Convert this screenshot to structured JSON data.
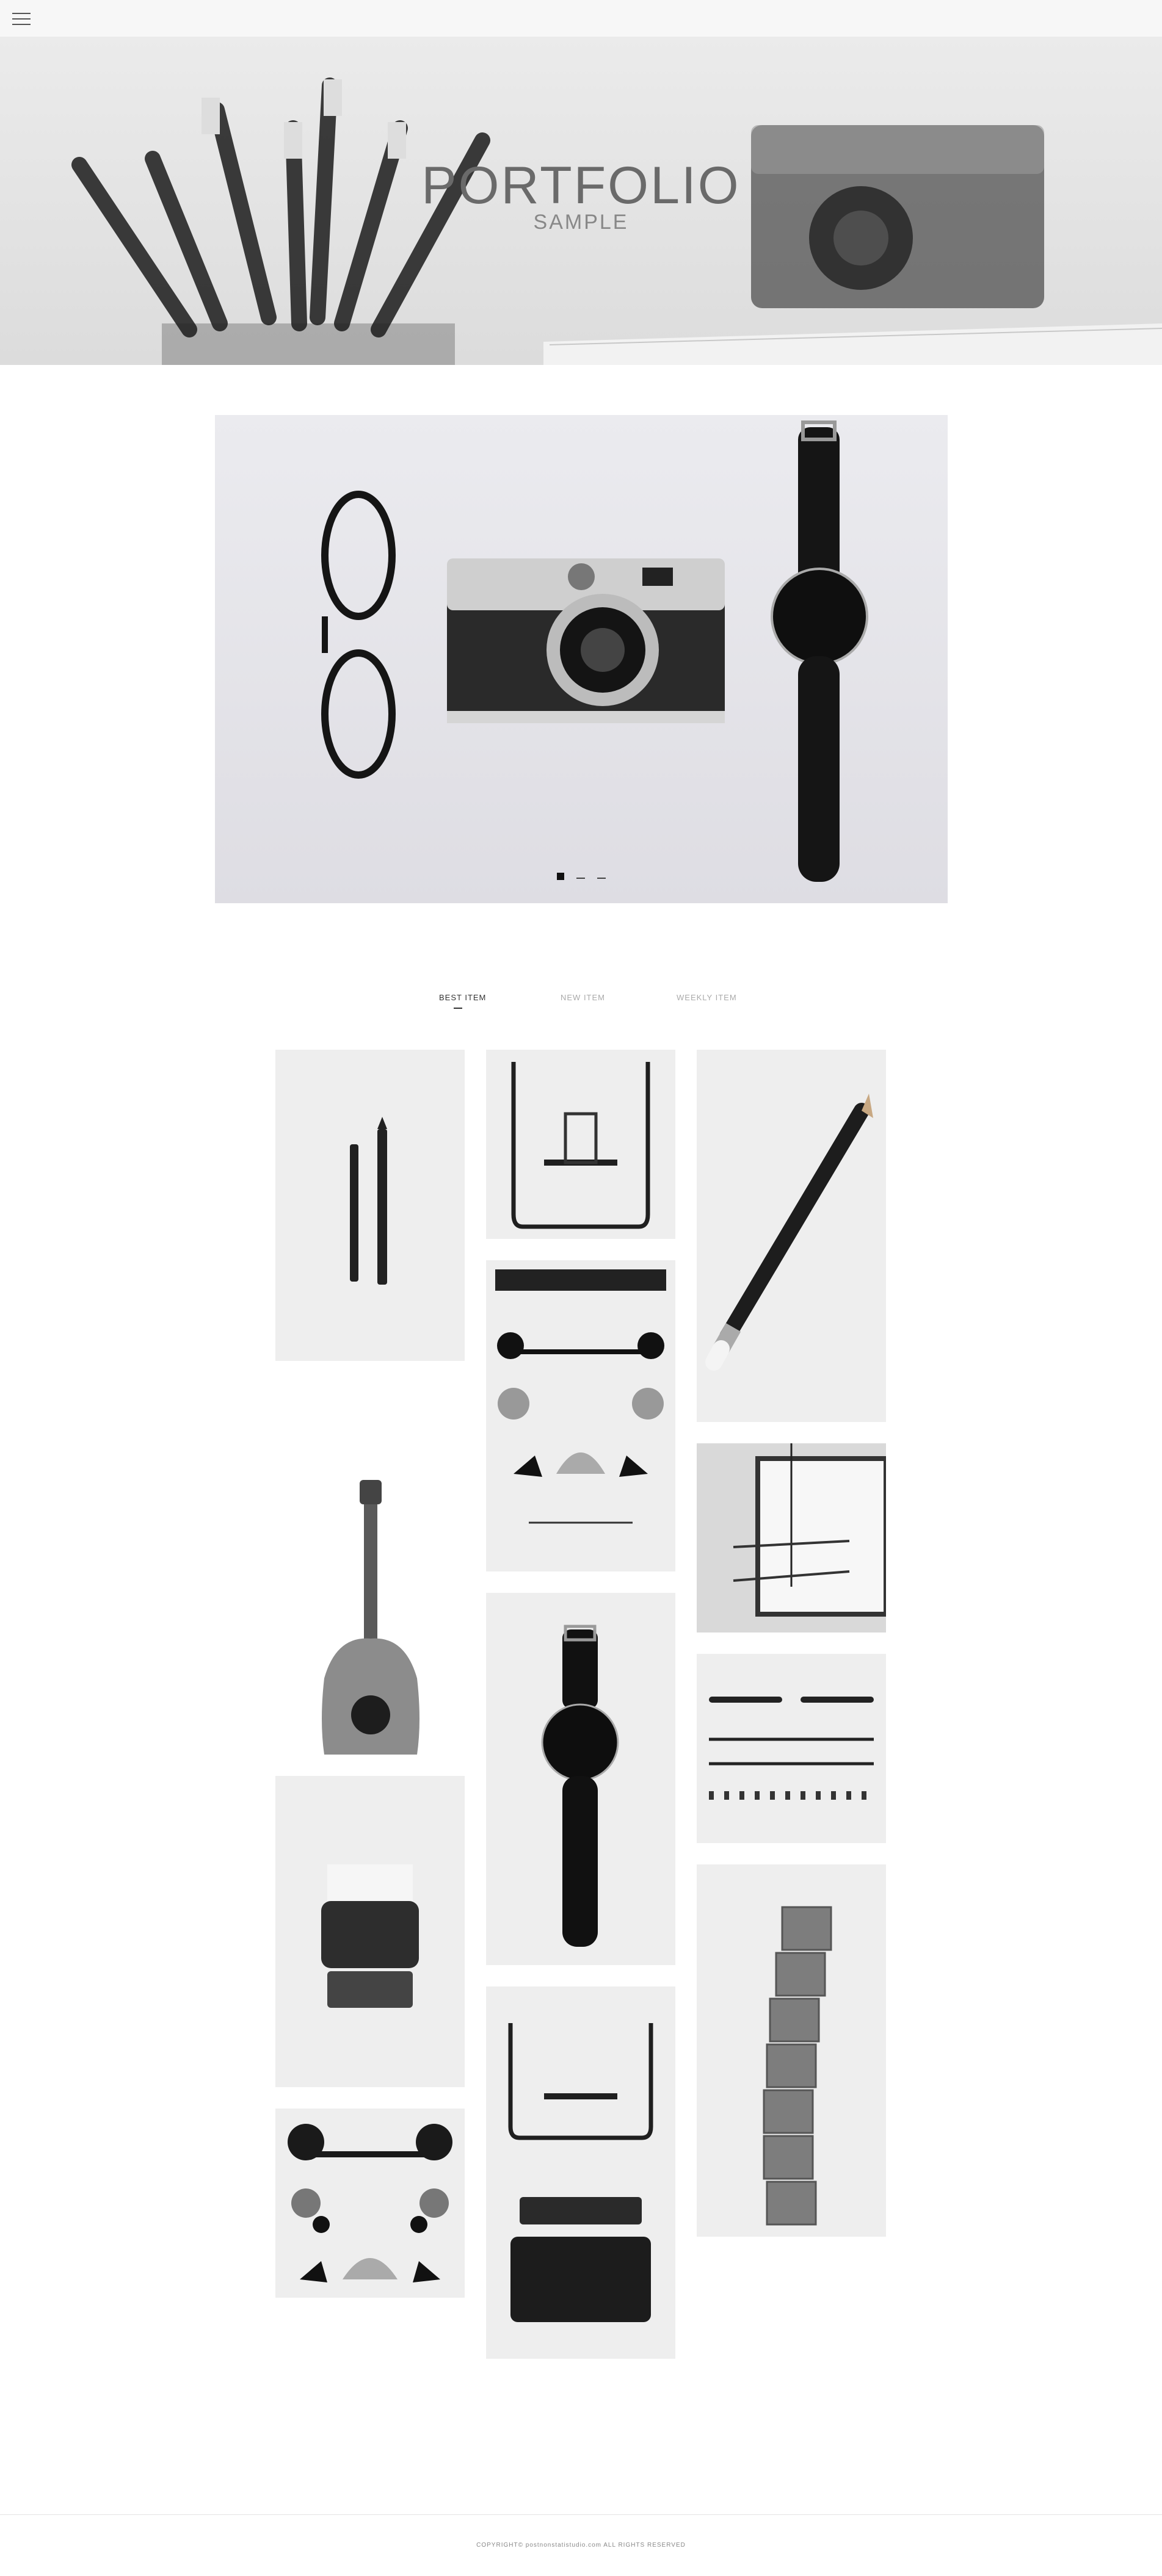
{
  "header": {
    "menu_icon": "hamburger-menu-icon"
  },
  "hero": {
    "title": "PORTFOLIO",
    "subtitle": "SAMPLE"
  },
  "slider": {
    "active_slide": 1,
    "total_slides": 3
  },
  "tabs": [
    {
      "label": "BEST ITEM",
      "active": true
    },
    {
      "label": "NEW ITEM",
      "active": false
    },
    {
      "label": "WEEKLY ITEM",
      "active": false
    }
  ],
  "gallery": {
    "items": [
      "pens",
      "stand-rack",
      "pencil",
      "desk-flatlay",
      "ceiling-lamp",
      "guitar",
      "wristwatch",
      "tool-set",
      "typewriter",
      "type-blocks",
      "binder-clips",
      "stand-and-stamps"
    ]
  },
  "footer": {
    "copyright": "COPYRIGHT© postnonstatistudio.com ALL RIGHTS RESERVED"
  }
}
